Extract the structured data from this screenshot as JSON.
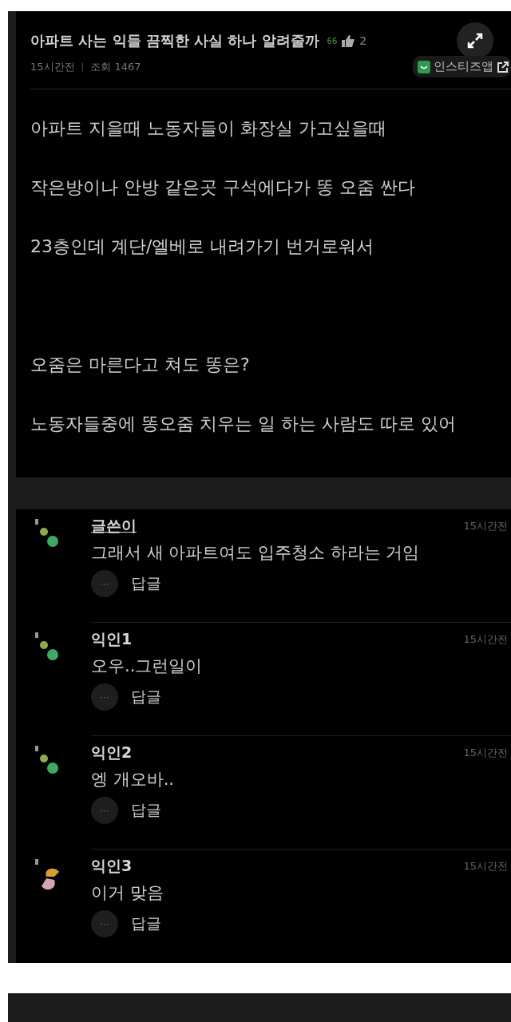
{
  "post": {
    "title": "아파트 사는 익들 끔찍한 사실 하나 알려줄까",
    "like_prefix": "66",
    "like_count": "2",
    "time": "15시간전",
    "separator": "|",
    "views": "조회 1467",
    "app_badge": "인스티즈앱",
    "paragraphs": [
      [
        "아파트 지을때 노동자들이 화장실 가고싶을때",
        "작은방이나 안방 같은곳 구석에다가 똥 오줌 싼다",
        "23층인데 계단/엘베로 내려가기 번거로워서"
      ],
      [
        "오줌은 마른다고 쳐도 똥은?",
        "노동자들중에 똥오줌 치우는 일 하는 사람도 따로 있어"
      ]
    ]
  },
  "comments": [
    {
      "author": "글쓴이",
      "is_writer": true,
      "kind": "dots",
      "time": "15시간전",
      "text": "그래서 새 아파트여도 입주청소 하라는 거임",
      "more": "···",
      "reply": "답글"
    },
    {
      "author": "익인1",
      "is_writer": false,
      "kind": "dots",
      "time": "15시간전",
      "text": "오우..그런일이",
      "more": "···",
      "reply": "답글"
    },
    {
      "author": "익인2",
      "is_writer": false,
      "kind": "dots",
      "time": "15시간전",
      "text": "엥 개오바..",
      "more": "···",
      "reply": "답글"
    },
    {
      "author": "익인3",
      "is_writer": false,
      "kind": "swirl",
      "time": "15시간전",
      "text": "이거 맞음",
      "more": "···",
      "reply": "답글"
    }
  ]
}
